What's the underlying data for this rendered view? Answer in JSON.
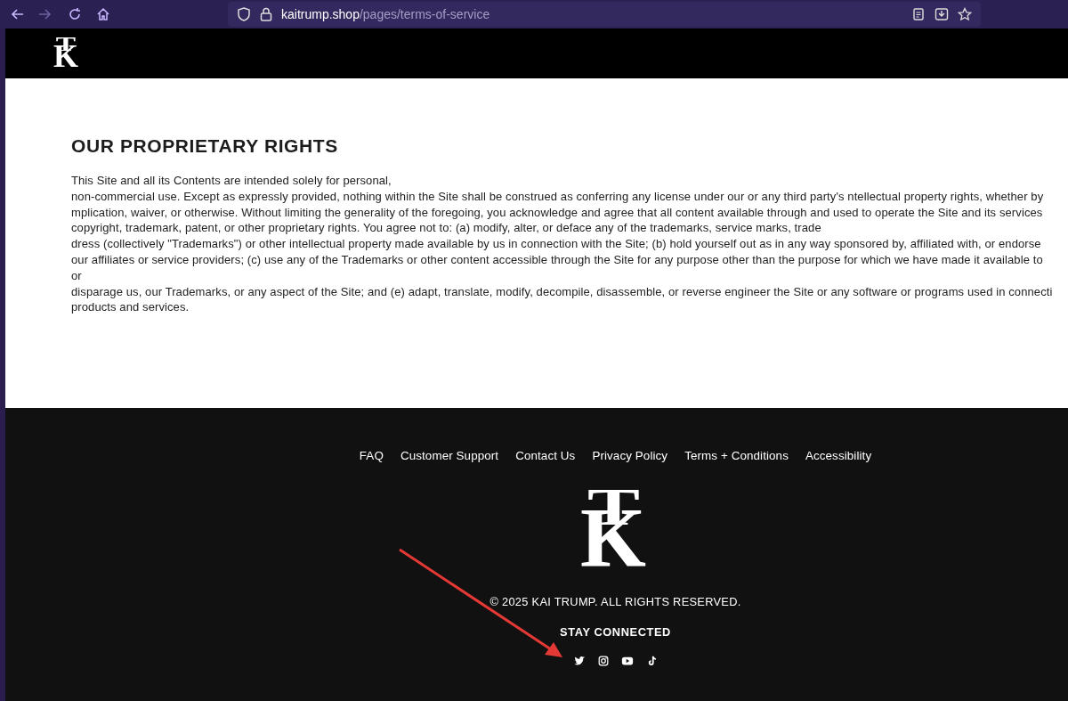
{
  "browser": {
    "url": {
      "host": "kaitrump.shop",
      "path": "/pages/terms-of-service"
    }
  },
  "header": {
    "logo": [
      "T",
      "K"
    ]
  },
  "section": {
    "heading": "OUR PROPRIETARY RIGHTS",
    "lines": [
      "This Site and all its Contents are intended solely for personal,",
      "non-commercial use. Except as expressly provided, nothing within the Site shall be construed as conferring any license under our or any third party's ntellectual property rights, whether by",
      "mplication, waiver, or otherwise. Without limiting the generality of the foregoing, you acknowledge and agree that all content available through and used to operate the Site and its services",
      "copyright, trademark, patent, or other proprietary rights. You agree not to: (a) modify, alter, or deface any of the trademarks, service marks, trade",
      "dress (collectively \"Trademarks\") or other intellectual property made available by us in connection with the Site; (b) hold yourself out as in any way sponsored by, affiliated with, or endorse",
      "our affiliates or service providers; (c) use any of the Trademarks or other content accessible through the Site for any purpose other than the purpose for which we have made it available to",
      "or",
      "disparage us, our Trademarks, or any aspect of the Site; and (e) adapt, translate, modify, decompile, disassemble, or reverse engineer the Site or any software or programs used in connecti",
      "products and services."
    ]
  },
  "footer": {
    "links": [
      "FAQ",
      "Customer Support",
      "Contact Us",
      "Privacy Policy",
      "Terms + Conditions",
      "Accessibility"
    ],
    "logo": [
      "T",
      "K"
    ],
    "copyright": "© 2025 KAI TRUMP. ALL RIGHTS RESERVED.",
    "social_heading": "STAY CONNECTED",
    "social": [
      {
        "kind": "twitter"
      },
      {
        "kind": "instagram"
      },
      {
        "kind": "youtube"
      },
      {
        "kind": "tiktok"
      }
    ]
  }
}
